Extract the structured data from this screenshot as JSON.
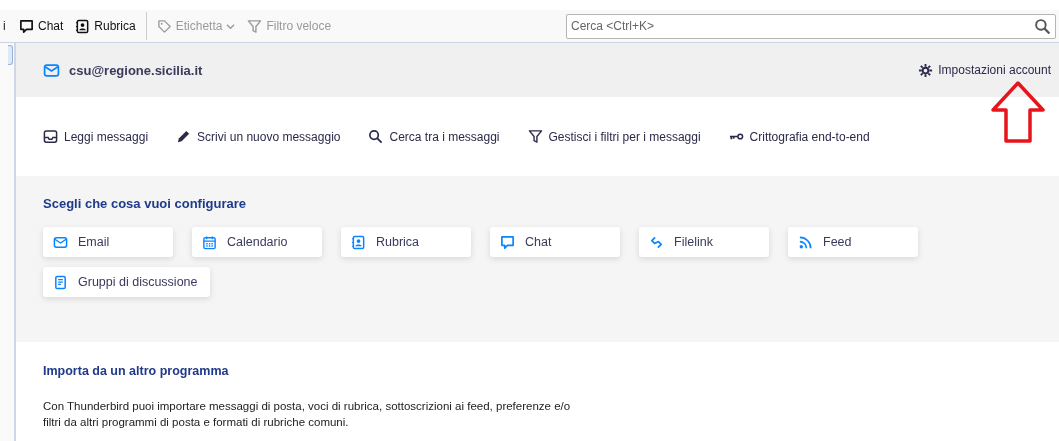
{
  "toolbar": {
    "cut_label": "i",
    "items": [
      {
        "label": "Chat",
        "kind": "chat",
        "disabled": false
      },
      {
        "label": "Rubrica",
        "kind": "addressbook",
        "disabled": false
      },
      {
        "label": "Etichetta",
        "kind": "tag",
        "disabled": true,
        "dropdown": true
      },
      {
        "label": "Filtro veloce",
        "kind": "filter",
        "disabled": true,
        "dropdown": false
      }
    ],
    "search": {
      "placeholder": "Cerca <Ctrl+K>"
    }
  },
  "account": {
    "email": "csu@regione.sicilia.it",
    "settings": "Impostazioni account"
  },
  "actions": [
    {
      "label": "Leggi messaggi",
      "kind": "inbox"
    },
    {
      "label": "Scrivi un nuovo messaggio",
      "kind": "pencil"
    },
    {
      "label": "Cerca tra i messaggi",
      "kind": "search"
    },
    {
      "label": "Gestisci i filtri per i messaggi",
      "kind": "filter"
    },
    {
      "label": "Crittografia end-to-end",
      "kind": "key"
    }
  ],
  "setup": {
    "title": "Scegli che cosa vuoi configurare",
    "tiles": [
      {
        "label": "Email",
        "kind": "email"
      },
      {
        "label": "Calendario",
        "kind": "calendar"
      },
      {
        "label": "Rubrica",
        "kind": "addressbook"
      },
      {
        "label": "Chat",
        "kind": "chat"
      },
      {
        "label": "Filelink",
        "kind": "link"
      },
      {
        "label": "Feed",
        "kind": "feed"
      },
      {
        "label": "Gruppi di discussione",
        "kind": "newsgroup"
      }
    ]
  },
  "import": {
    "title": "Importa da un altro programma",
    "text": "Con Thunderbird puoi importare messaggi di posta, voci di rubrica, sottoscrizioni ai feed, preferenze e/o filtri da altri programmi di posta e formati di rubriche comuni."
  }
}
